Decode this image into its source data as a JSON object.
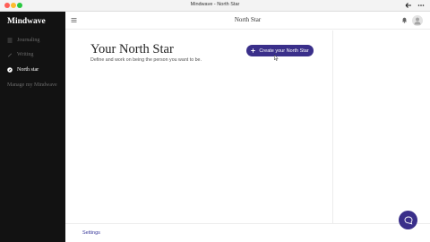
{
  "window": {
    "title": "Mindwave - North Star"
  },
  "sidebar": {
    "brand": "Mindwave",
    "items": [
      {
        "label": "Journaling",
        "icon": "list-icon",
        "active": false
      },
      {
        "label": "Writing",
        "icon": "pencil-icon",
        "active": false
      },
      {
        "label": "North star",
        "icon": "compass-icon",
        "active": true
      },
      {
        "label": "Manage my Mindwave",
        "icon": "",
        "active": false
      }
    ]
  },
  "header": {
    "title": "North Star"
  },
  "main": {
    "heading": "Your North Star",
    "subheading": "Define and work on being the person you want to be.",
    "create_button": "Create your North Star"
  },
  "footer": {
    "settings_label": "Settings"
  },
  "colors": {
    "sidebar_bg": "#121212",
    "accent": "#3a2f8a",
    "link": "#3a3a9a"
  }
}
